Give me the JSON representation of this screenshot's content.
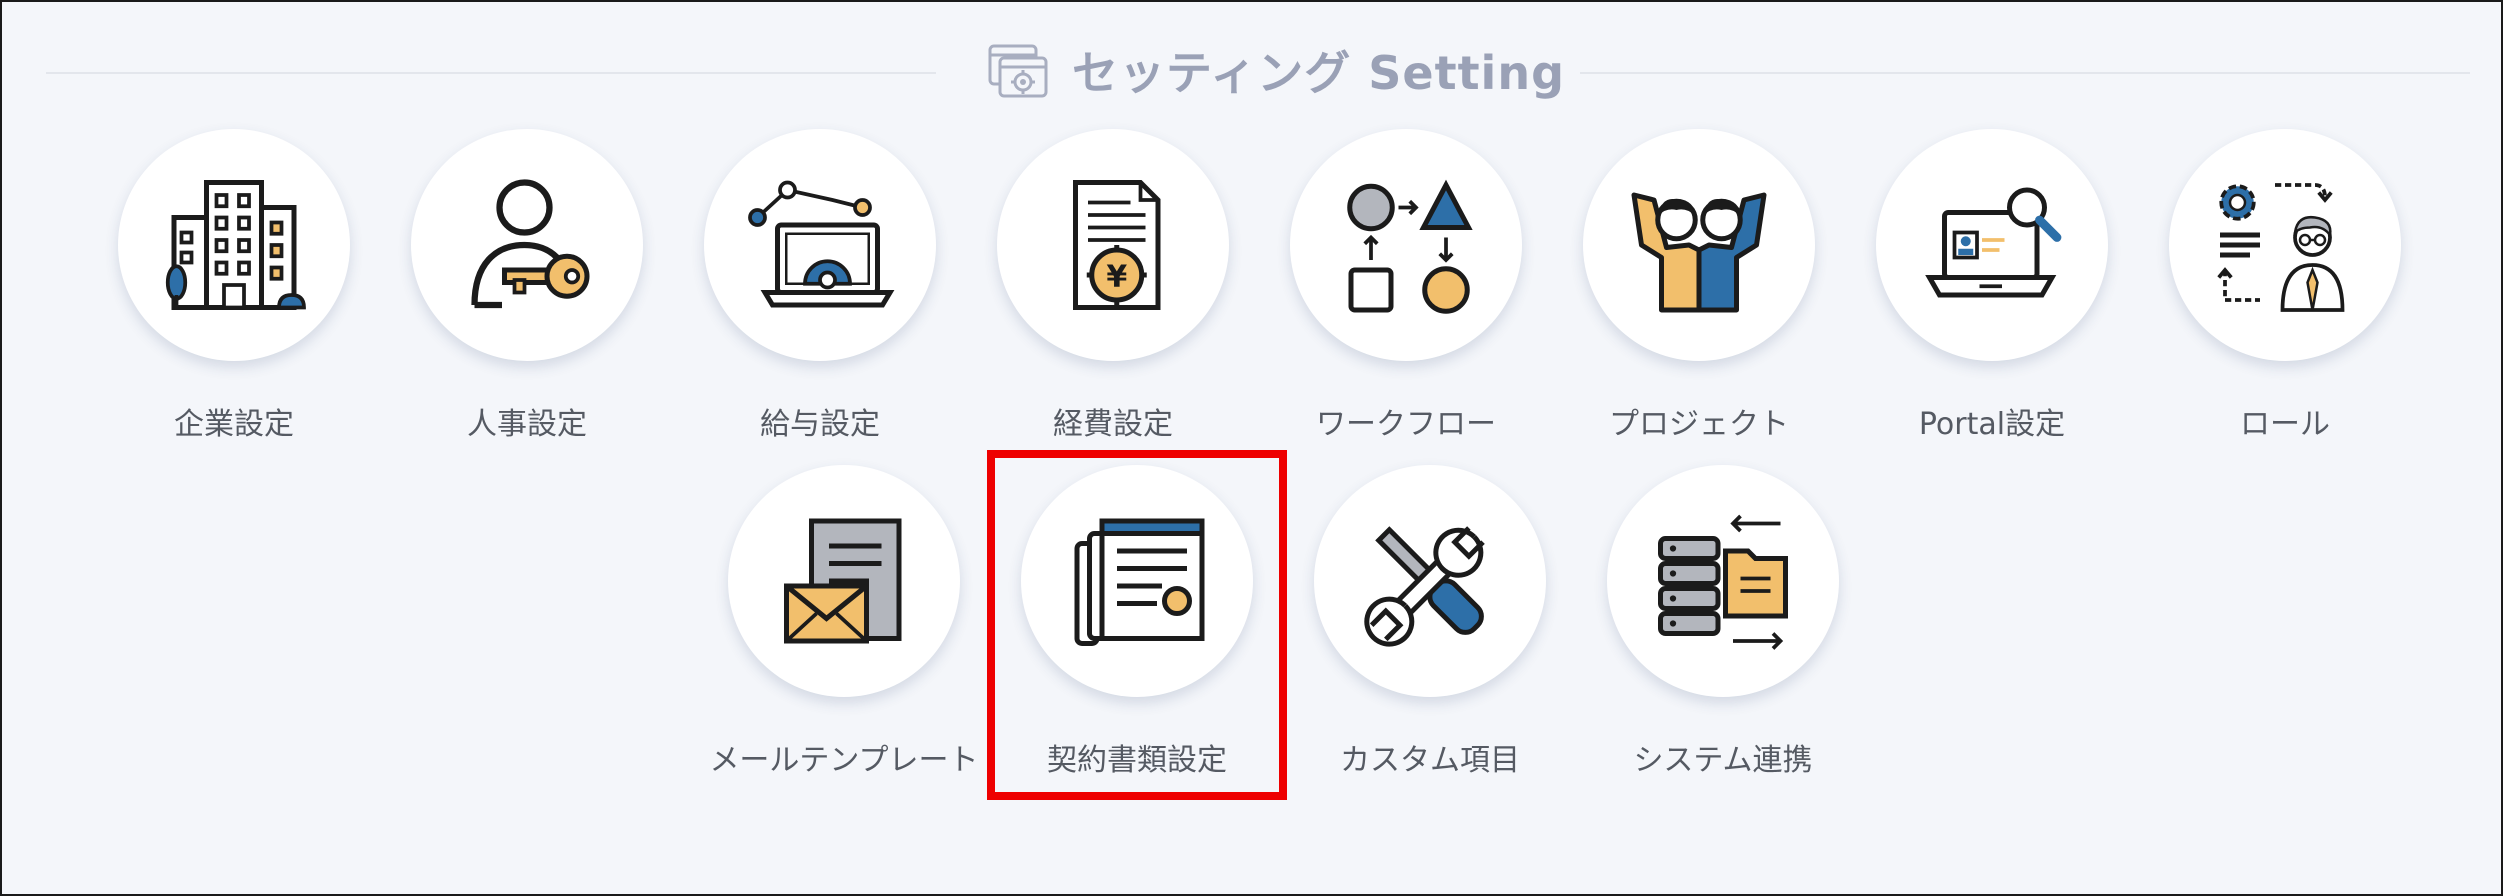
{
  "header": {
    "title": "セッティング Setting",
    "icon": "settings-window-icon"
  },
  "colors": {
    "title": "#9aa1b6",
    "label": "#555a63",
    "highlight": "#ee0000",
    "icon_blue": "#2d6fa8",
    "icon_orange": "#f2bf6c"
  },
  "tiles_row1": [
    {
      "label": "企業設定",
      "icon": "office-building-icon"
    },
    {
      "label": "人事設定",
      "icon": "user-key-icon"
    },
    {
      "label": "給与設定",
      "icon": "laptop-gear-chart-icon"
    },
    {
      "label": "経費設定",
      "icon": "yen-document-icon"
    },
    {
      "label": "ワークフロー",
      "icon": "workflow-shapes-icon"
    },
    {
      "label": "プロジェクト",
      "icon": "team-people-icon"
    },
    {
      "label": "Portal設定",
      "icon": "laptop-search-profile-icon"
    },
    {
      "label": "ロール",
      "icon": "role-gear-person-icon"
    }
  ],
  "tiles_row2": [
    {
      "label": "メールテンプレート",
      "icon": "mail-template-icon"
    },
    {
      "label": "契約書類設定",
      "icon": "contract-documents-icon",
      "highlighted": true
    },
    {
      "label": "カスタム項目",
      "icon": "tools-wrench-screwdriver-icon"
    },
    {
      "label": "システム連携",
      "icon": "server-folder-sync-icon"
    }
  ]
}
